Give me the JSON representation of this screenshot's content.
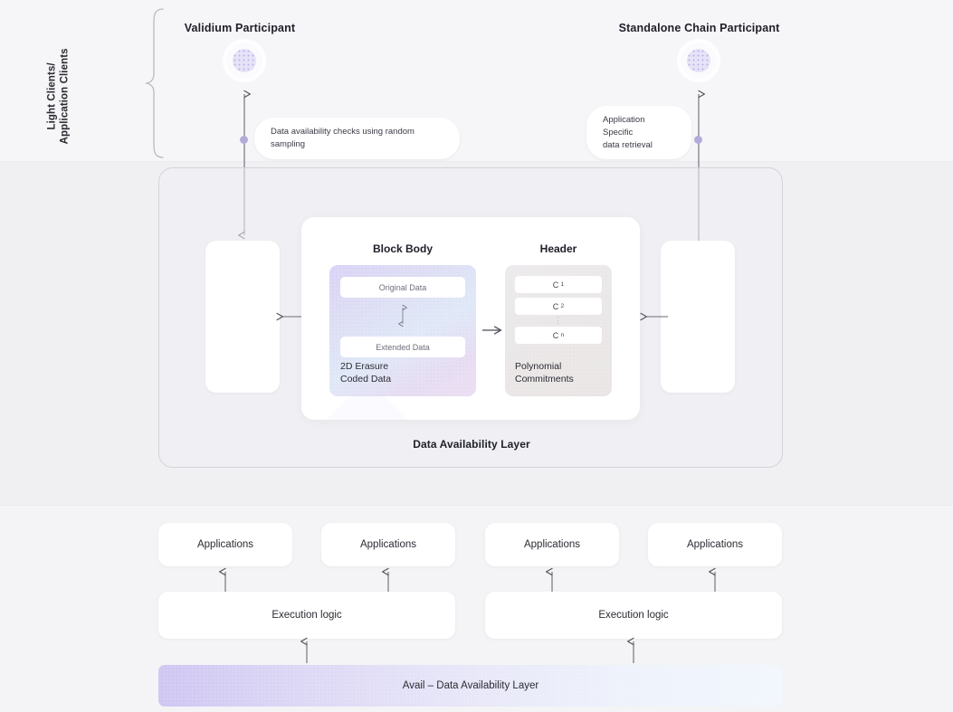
{
  "diagram": {
    "title": "Avail Data Availability Layer Architecture",
    "background_color": "#f3f3f5",
    "accent_color": "#b3acd8"
  },
  "clients_section": {
    "bracket_label": "Light Clients/\nApplication Clients",
    "participants": [
      {
        "id": "validium",
        "title": "Validium Participant",
        "tooltip": "Data availability checks using random sampling",
        "arrow_type": "double",
        "node_icon": "dotted-circle-node"
      },
      {
        "id": "standalone",
        "title": "Standalone Chain Participant",
        "tooltip": "Application Specific\ndata retrieval",
        "arrow_type": "single-up",
        "node_icon": "dotted-circle-node"
      }
    ]
  },
  "da_layer": {
    "label": "Data Availability Layer",
    "block_card": {
      "block_body": {
        "heading": "Block Body",
        "rows": [
          "Original Data",
          "Extended Data"
        ],
        "caption": "2D Erasure\nCoded Data",
        "inner_arrow": "double-vertical-arrow",
        "gradient_from": "#d9d3f6",
        "gradient_to": "#ebdef3"
      },
      "header": {
        "heading": "Header",
        "commitments": [
          {
            "symbol": "C",
            "sub": "1"
          },
          {
            "symbol": "C",
            "sub": "2"
          }
        ],
        "ellipsis": "⋮",
        "last_commitment": {
          "symbol": "C",
          "sub": "n"
        },
        "caption": "Polynomial\nCommitments"
      },
      "between_arrow": "arrow-right"
    },
    "side_cards": [
      {
        "id": "left-node-card",
        "arrow": "arrow-left"
      },
      {
        "id": "right-node-card",
        "arrow": "arrow-left"
      }
    ]
  },
  "stack": {
    "applications": [
      {
        "label": "Applications"
      },
      {
        "label": "Applications"
      },
      {
        "label": "Applications"
      },
      {
        "label": "Applications"
      }
    ],
    "execution_logic": [
      {
        "label": "Execution logic"
      },
      {
        "label": "Execution logic"
      }
    ],
    "base_layer": {
      "label": "Avail – Data Availability Layer",
      "gradient_from": "#cfc6f2",
      "gradient_to": "#f2f6fd"
    }
  }
}
